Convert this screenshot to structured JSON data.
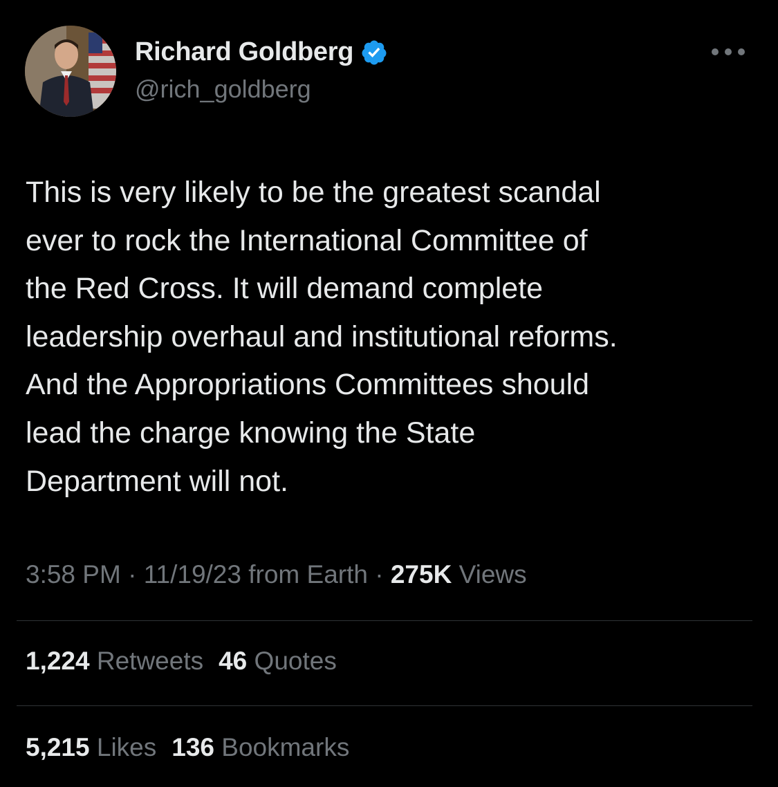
{
  "author": {
    "name": "Richard Goldberg",
    "handle": "@rich_goldberg",
    "verified_color": "#1d9bf0"
  },
  "tweet": {
    "lines": [
      "This is very likely to be the greatest scandal",
      "ever to rock the International Committee of",
      "the Red Cross. It will demand complete",
      "leadership overhaul and institutional reforms.",
      "And the Appropriations Committees should",
      "lead the charge knowing the State",
      "Department will not."
    ],
    "time": "3:58 PM",
    "date": "11/19/23",
    "source": "from Earth",
    "separator": " · ",
    "views_count": "275K",
    "views_label": "Views"
  },
  "engagement": {
    "retweets_count": "1,224",
    "retweets_label": "Retweets",
    "quotes_count": "46",
    "quotes_label": "Quotes",
    "likes_count": "5,215",
    "likes_label": "Likes",
    "bookmarks_count": "136",
    "bookmarks_label": "Bookmarks"
  },
  "icons": {
    "more": "more-horizontal-icon",
    "verified": "verified-badge-icon"
  },
  "colors": {
    "background": "#000000",
    "text_primary": "#e7e9ea",
    "text_secondary": "#71767b",
    "divider": "#2f3336"
  }
}
